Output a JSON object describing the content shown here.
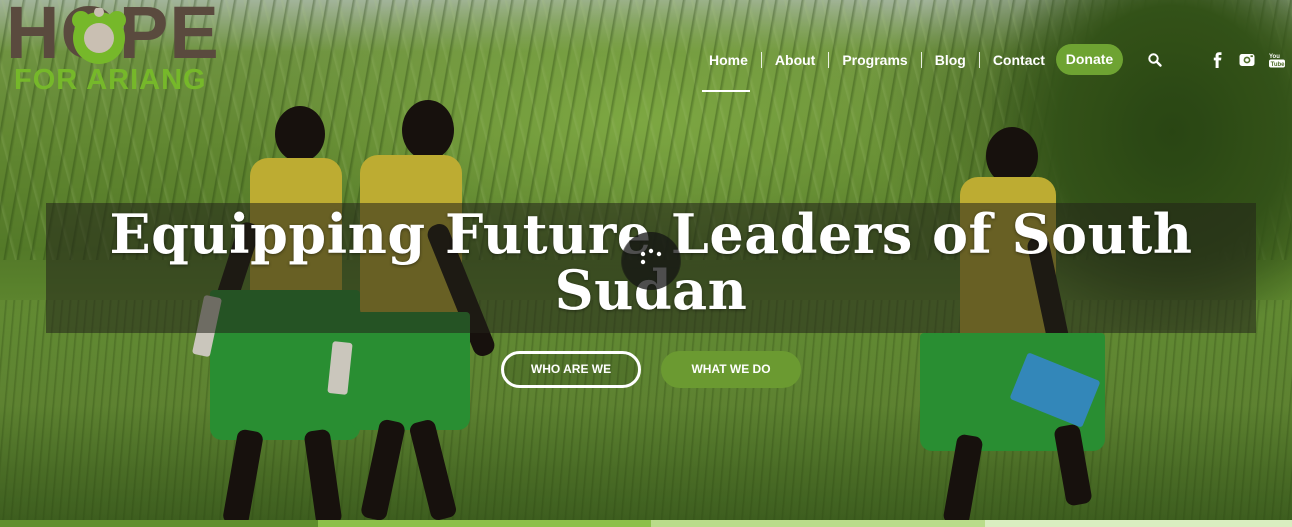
{
  "logo": {
    "title": "HOPE",
    "subtitle": "FOR ARIANG"
  },
  "nav": {
    "items": [
      "Home",
      "About",
      "Programs",
      "Blog",
      "Contact"
    ],
    "active": "Home",
    "donate_label": "Donate"
  },
  "icons": {
    "search": "search-icon",
    "social": [
      "facebook-icon",
      "instagram-icon",
      "youtube-icon"
    ]
  },
  "hero": {
    "headline": "Equipping Future Leaders of South Sudan",
    "buttons": {
      "primary": "WHO ARE WE",
      "secondary": "WHAT WE DO"
    }
  },
  "colors": {
    "brand_green": "#76b82a",
    "button_green": "#6b9a31",
    "logo_brown": "#5a4a3e",
    "strip": [
      "#5f8f2d",
      "#8cc04a",
      "#b9dc8a",
      "#d9eec0"
    ]
  }
}
